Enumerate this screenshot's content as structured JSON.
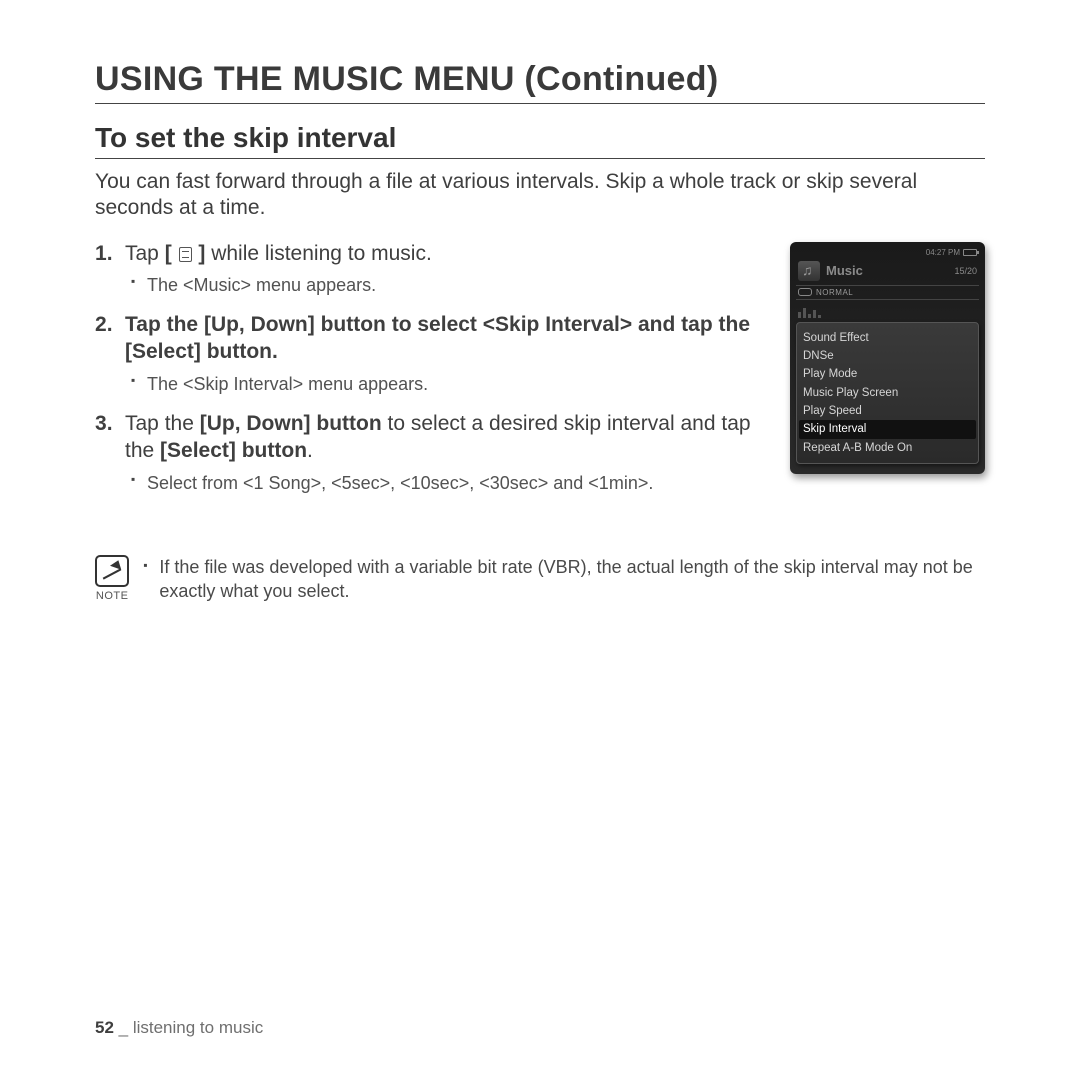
{
  "title_main": "USING THE MUSIC MENU (Continued)",
  "title_sub": "To set the skip interval",
  "intro": "You can fast forward through a file at various intervals. Skip a whole track or skip several seconds at a time.",
  "steps": {
    "s1_pre": "Tap ",
    "s1_post": " while listening to music.",
    "s1_bullet": "The <Music> menu appears.",
    "s2": "Tap the [Up, Down] button to select <Skip Interval> and tap the [Select] button.",
    "s2_bullet": "The <Skip Interval> menu appears.",
    "s3_a": "Tap the ",
    "s3_b": "[Up, Down] button",
    "s3_c": " to select a desired skip interval and tap the ",
    "s3_d": "[Select] button",
    "s3_e": ".",
    "s3_bullet": "Select from <1 Song>, <5sec>, <10sec>, <30sec> and <1min>."
  },
  "icon_open_bracket": "[ ",
  "icon_close_bracket": " ]",
  "device": {
    "time": "04:27 PM",
    "header": "Music",
    "count": "15/20",
    "normal": "NORMAL",
    "menu": [
      "Sound Effect",
      "DNSe",
      "Play Mode",
      "Music Play Screen",
      "Play Speed",
      "Skip Interval",
      "Repeat A-B Mode On"
    ],
    "selected_index": 5
  },
  "note": {
    "caption": "NOTE",
    "text": "If the file was developed with a variable bit rate (VBR), the actual length of the skip interval may not be exactly what you select."
  },
  "footer": {
    "page": "52",
    "sep": " _ ",
    "section": "listening to music"
  }
}
